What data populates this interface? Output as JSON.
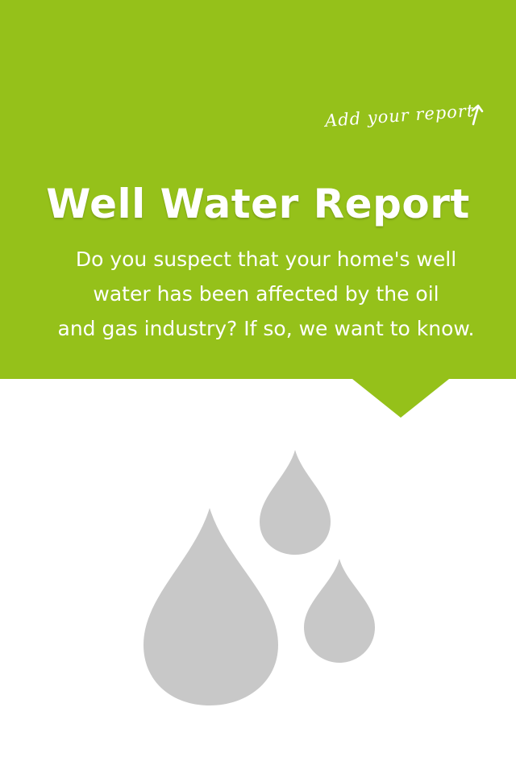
{
  "header": {
    "add_report_label": "Add your report",
    "add_report_icon": "arrow-up-icon",
    "title": "Well Water Report",
    "intro_lines": [
      "Do you suspect that your home's well",
      "water has been affected by the oil",
      "and gas industry? If so, we want to know."
    ]
  },
  "illustration": {
    "icon": "water-drops-icon"
  },
  "colors": {
    "brand_green": "#95c11a",
    "drop_gray": "#c8c8c8",
    "text_white": "#ffffff",
    "background": "#ffffff"
  }
}
